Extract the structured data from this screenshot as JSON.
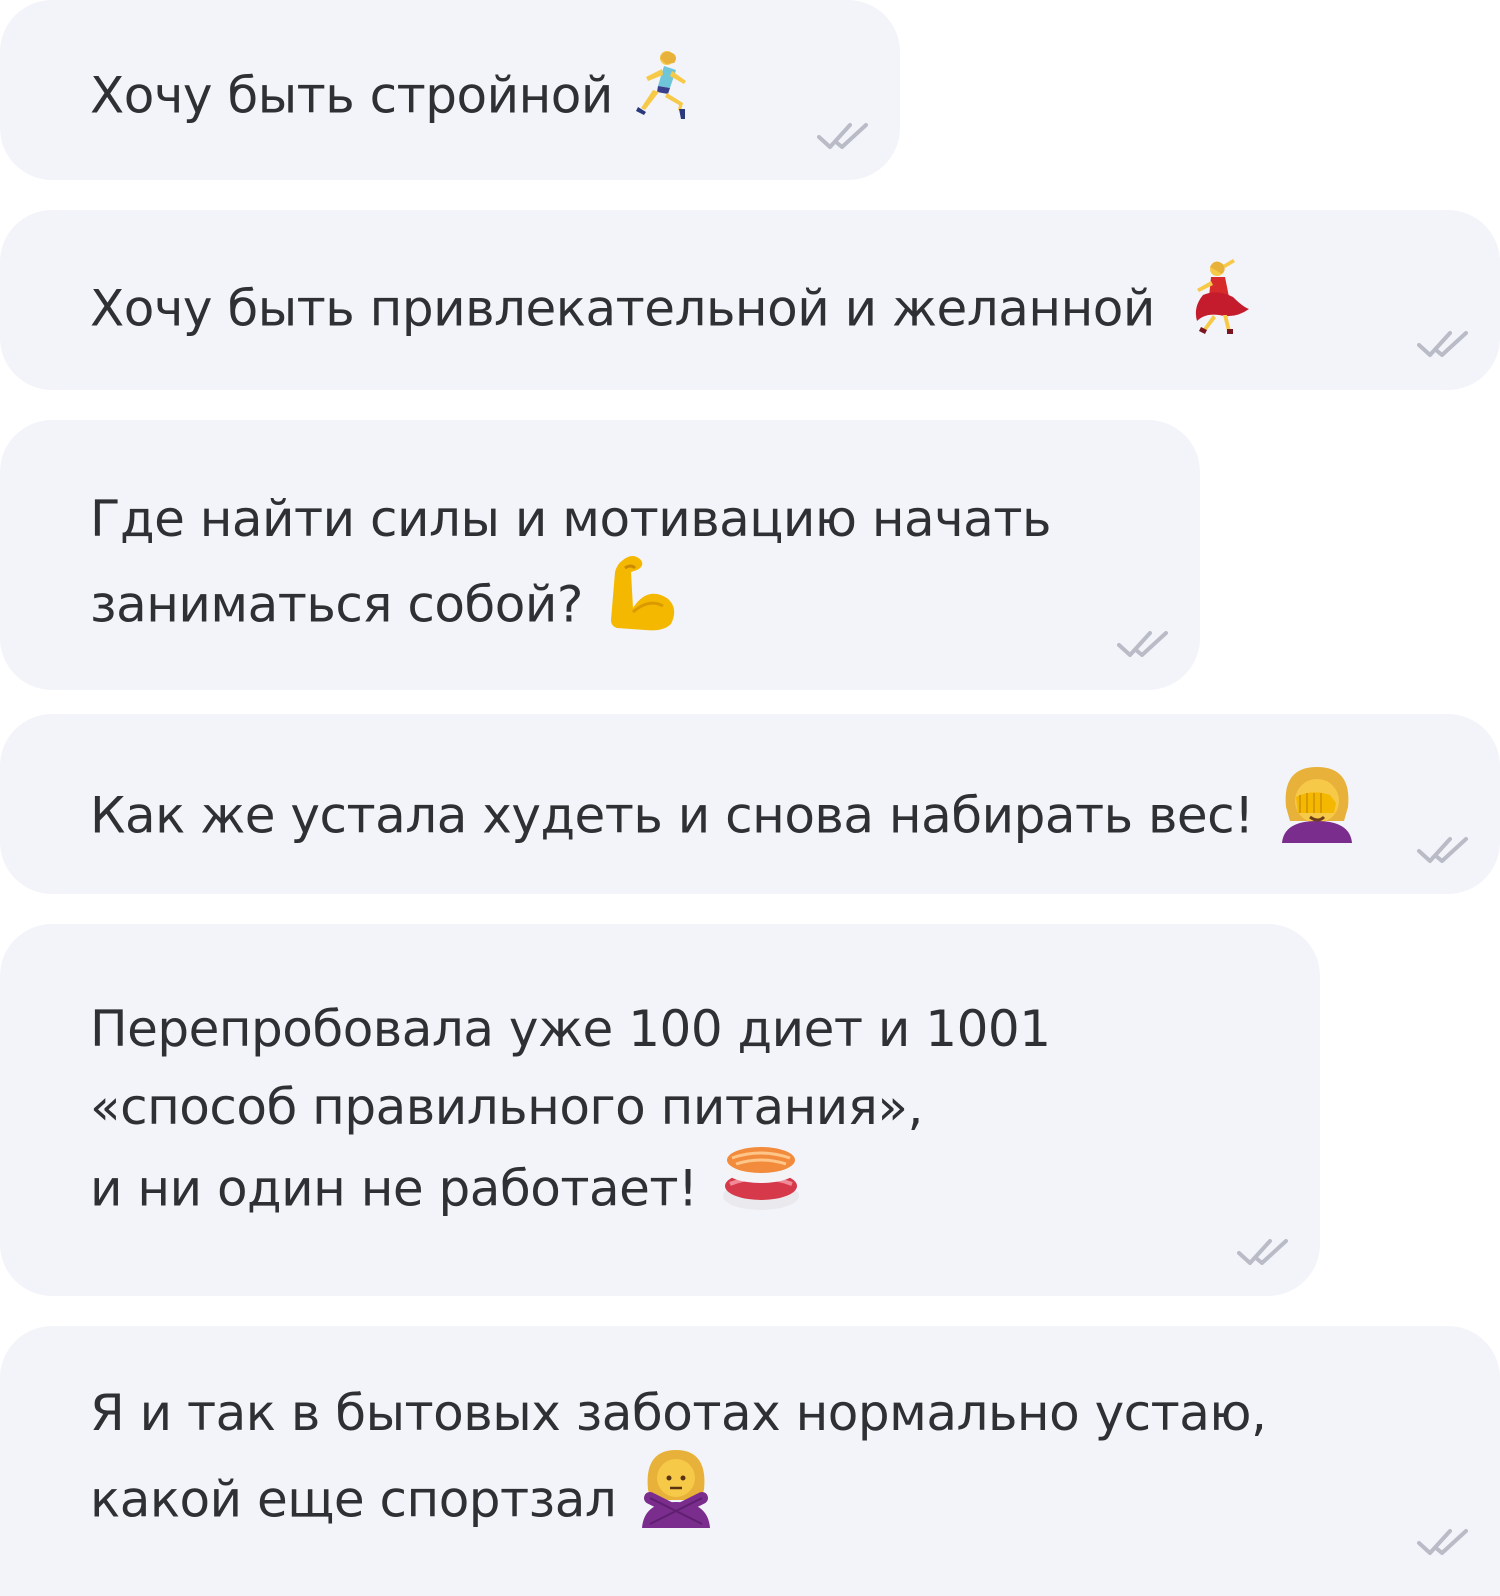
{
  "chat": {
    "messages": [
      {
        "lines": [
          "Хочу быть стройной"
        ],
        "emoji": "woman-running-icon",
        "status": "read-double-check-icon"
      },
      {
        "lines": [
          "Хочу быть привлекательной и желанной"
        ],
        "emoji": "woman-dancing-icon",
        "status": "read-double-check-icon"
      },
      {
        "lines": [
          "Где найти силы и мотивацию начать",
          "заниматься собой?"
        ],
        "emoji": "flexed-biceps-icon",
        "status": "read-double-check-icon"
      },
      {
        "lines": [
          "Как же устала худеть и снова набирать вес!"
        ],
        "emoji": "woman-facepalming-icon",
        "status": "read-double-check-icon"
      },
      {
        "lines": [
          "Перепробовала уже 100 диет и 1001",
          "«способ правильного питания»,",
          "и ни один не работает!"
        ],
        "emoji": "sushi-icon",
        "status": "read-double-check-icon"
      },
      {
        "lines": [
          "Я и так в бытовых заботах нормально устаю,",
          "какой еще спортзал"
        ],
        "emoji": "woman-gesturing-no-icon",
        "status": "read-double-check-icon"
      }
    ]
  },
  "colors": {
    "bubble_background": "#f3f4f9",
    "text": "#2f3033",
    "ticks": "#b9bbc6"
  }
}
